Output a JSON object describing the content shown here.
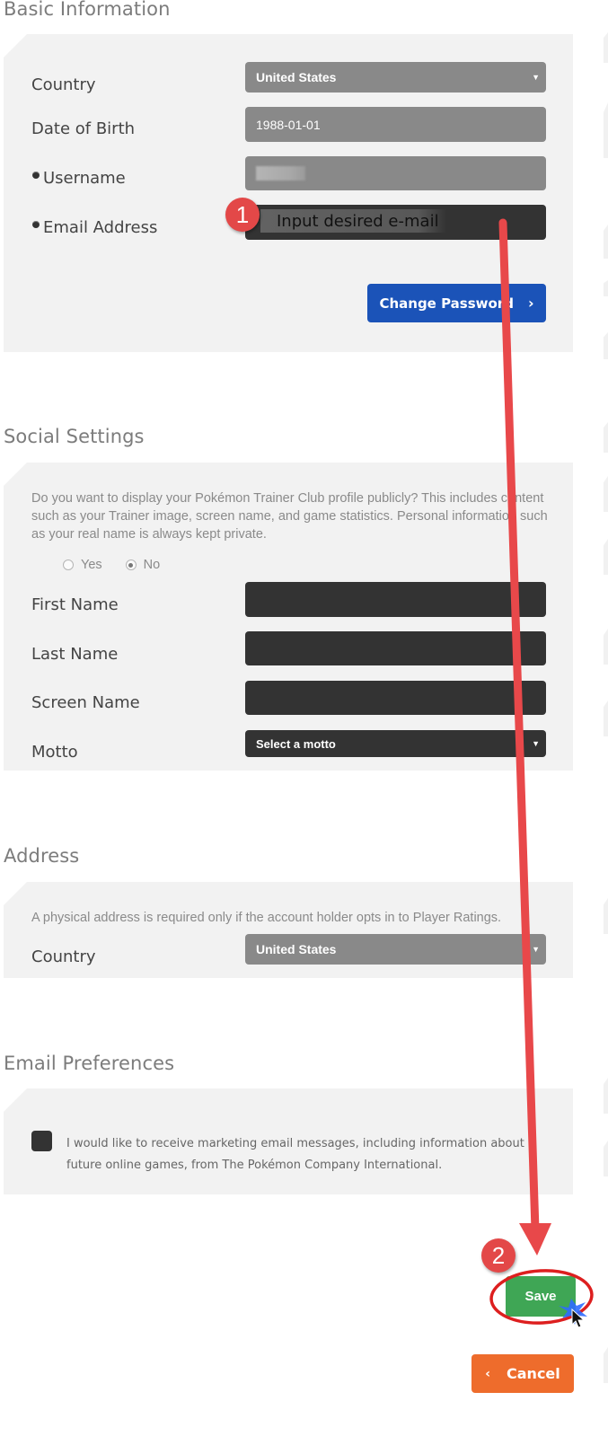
{
  "basic_info": {
    "title": "Basic Information",
    "fields": {
      "country": {
        "label": "Country",
        "value": "United States",
        "icon": "caret-down-icon"
      },
      "dob": {
        "label": "Date of Birth",
        "value": "1988-01-01"
      },
      "username": {
        "label": "Username",
        "value": "",
        "required": true,
        "redacted": true
      },
      "email": {
        "label": "Email Address",
        "value": "",
        "required": true
      }
    },
    "change_password_label": "Change Password",
    "change_password_icon": "chevron-right-icon"
  },
  "social": {
    "title": "Social Settings",
    "description": "Do you want to display your Pokémon Trainer Club profile publicly? This includes content such as your Trainer image, screen name, and game statistics. Personal information such as your real name is always kept private.",
    "radio": {
      "options": [
        {
          "label": "Yes",
          "checked": false
        },
        {
          "label": "No",
          "checked": true
        }
      ]
    },
    "fields": {
      "first_name": {
        "label": "First Name",
        "value": ""
      },
      "last_name": {
        "label": "Last Name",
        "value": ""
      },
      "screen_name": {
        "label": "Screen Name",
        "value": ""
      },
      "motto": {
        "label": "Motto",
        "value": "Select a motto",
        "icon": "caret-down-icon"
      }
    }
  },
  "address": {
    "title": "Address",
    "description": "A physical address is required only if the account holder opts in to Player Ratings.",
    "country": {
      "label": "Country",
      "value": "United States",
      "icon": "caret-down-icon"
    }
  },
  "email_prefs": {
    "title": "Email Preferences",
    "marketing_checkbox": {
      "checked": false,
      "label": "I would like to receive marketing email messages, including information about future online games, from The Pokémon Company International."
    }
  },
  "actions": {
    "save_label": "Save",
    "cancel_label": "Cancel",
    "cancel_icon": "chevron-left-icon"
  },
  "annotations": {
    "step1": {
      "number": "1",
      "text": "Input desired e-mail"
    },
    "step2": {
      "number": "2"
    },
    "color": "#e34848"
  },
  "colors": {
    "primary_blue": "#1b53b8",
    "save_green": "#3fa655",
    "cancel_orange": "#ee6c2c",
    "input_dark": "#333333",
    "input_gray": "#898989",
    "panel_bg": "#f2f2f2"
  }
}
